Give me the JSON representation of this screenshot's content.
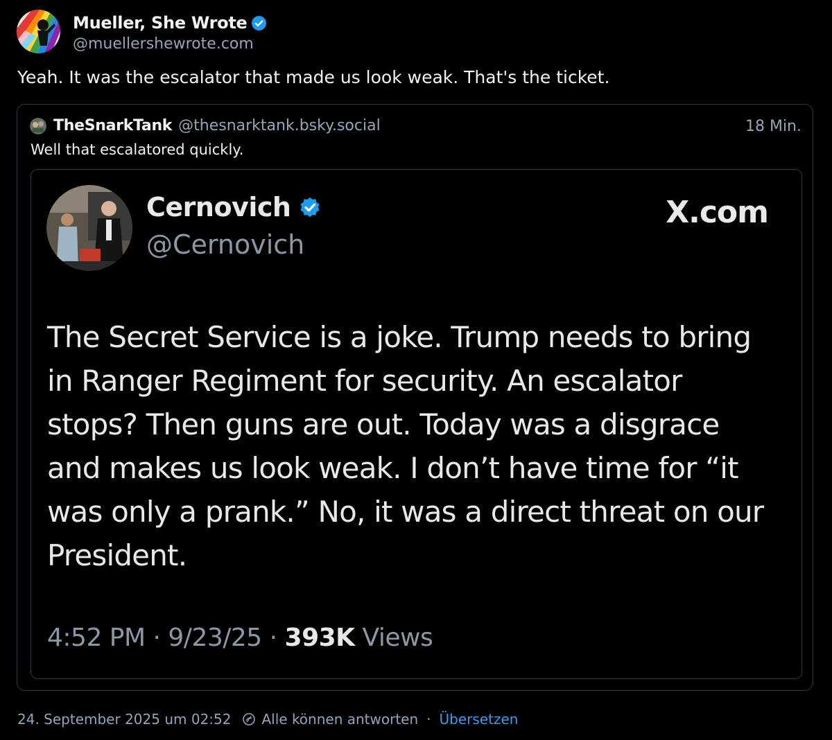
{
  "post": {
    "author_name": "Mueller, She Wrote",
    "author_handle": "@muellershewrote.com",
    "text": "Yeah. It was the escalator that made us look weak. That's the ticket."
  },
  "quote": {
    "author_name": "TheSnarkTank",
    "author_handle": "@thesnarktank.bsky.social",
    "time": "18 Min.",
    "text": "Well that escalatored quickly.",
    "embedded_tweet": {
      "name": "Cernovich",
      "handle": "@Cernovich",
      "brand": "X.com",
      "body_lines": [
        "The Secret Service is a joke. Trump needs to bring",
        "in Ranger Regiment for security. An escalator",
        "stops? Then guns are out. Today was a disgrace",
        "and makes us look weak. I don’t have time for “it",
        "was only a prank.” No, it was a direct threat on our",
        "President."
      ],
      "time": "4:52 PM",
      "date": "9/23/25",
      "views_count": "393K",
      "views_label": "Views"
    }
  },
  "footer": {
    "timestamp": "24. September 2025 um 02:52",
    "reply_setting": "Alle können antworten",
    "separator": "·",
    "translate": "Übersetzen"
  },
  "icons": {
    "verified": "verified-badge-icon",
    "reply_setting": "reply-permission-icon"
  },
  "colors": {
    "background": "#000000",
    "text_primary": "#f1f3f5",
    "text_secondary": "#93a5b7",
    "link": "#3b9af1",
    "verified": "#1d9bf0",
    "border": "#2e3840"
  }
}
